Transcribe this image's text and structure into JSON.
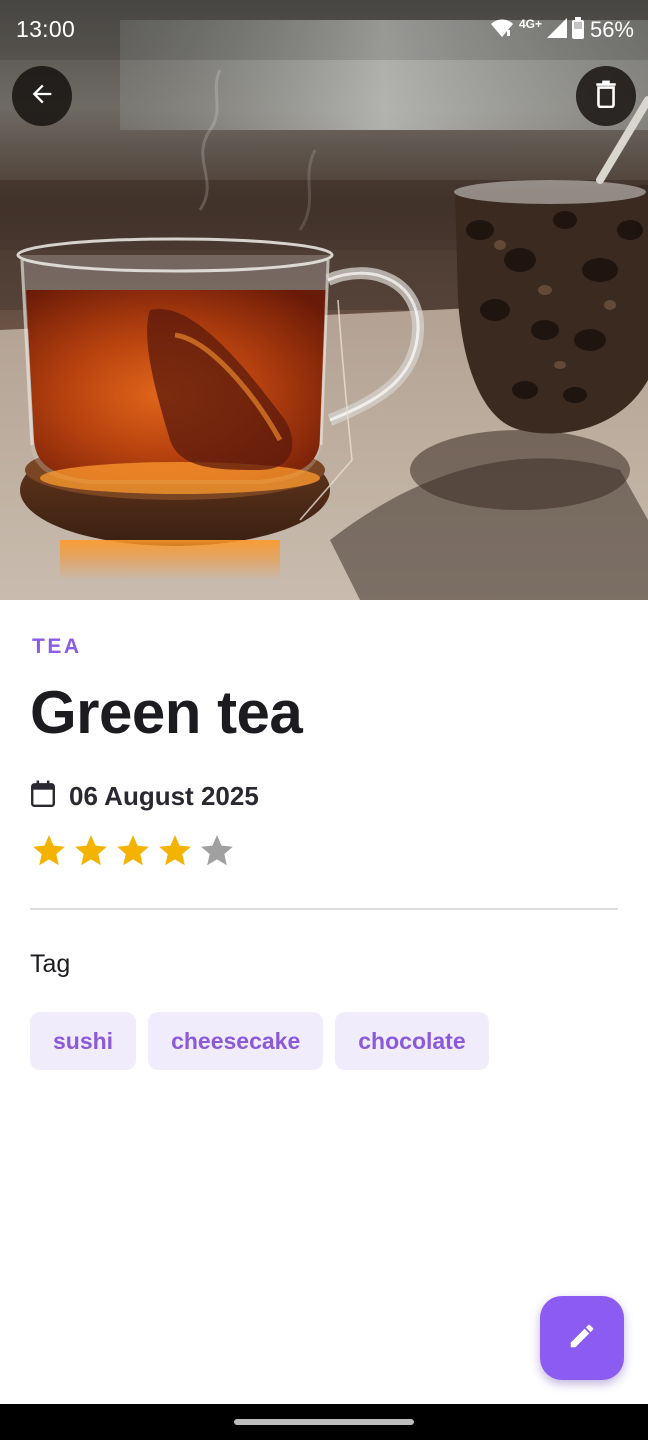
{
  "status_bar": {
    "time": "13:00",
    "network": "4G+",
    "battery": "56%"
  },
  "hero": {
    "image_subject": "glass cup of tea on a cork coaster"
  },
  "toolbar": {
    "back_icon": "arrow-left-icon",
    "delete_icon": "trash-icon"
  },
  "entry": {
    "category": "TEA",
    "title": "Green tea",
    "date": "06 August 2025",
    "rating": 4,
    "rating_max": 5
  },
  "tags_section": {
    "label": "Tag",
    "tags": [
      "sushi",
      "cheesecake",
      "chocolate"
    ]
  },
  "fab": {
    "icon": "pencil-icon"
  },
  "colors": {
    "accent": "#8c5cf2",
    "category_text": "#8c5ce6",
    "chip_bg": "#f1ecfc",
    "chip_text": "#8a5ad8",
    "star_filled": "#f5b301",
    "star_empty": "#a0a0a0"
  }
}
